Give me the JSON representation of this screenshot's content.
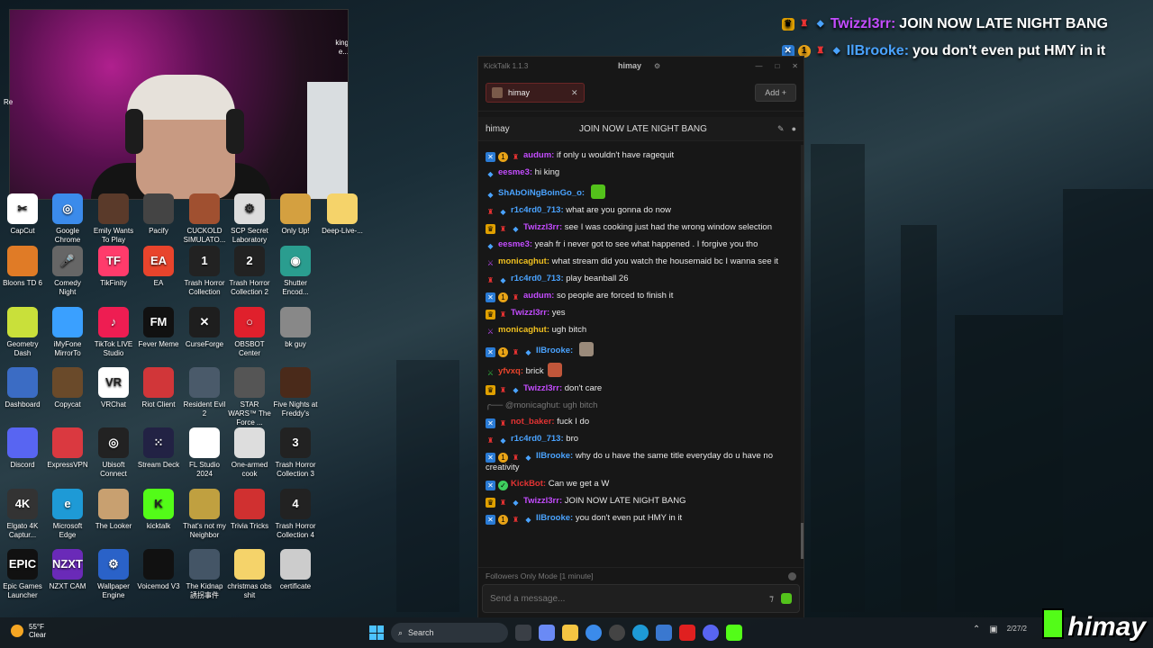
{
  "overlay": {
    "lines": [
      {
        "user": "Twizzl3rr:",
        "text": "JOIN NOW LATE NIGHT BANG"
      },
      {
        "user": "IlBrooke:",
        "text": "you don't even put HMY in it"
      }
    ]
  },
  "desktop": {
    "partial_labels": [
      "king",
      "e...",
      "Re"
    ],
    "icons": [
      {
        "label": "CapCut",
        "color": "#ffffff",
        "glyph": "✂"
      },
      {
        "label": "Google Chrome",
        "color": "#3b8beb",
        "glyph": "◎"
      },
      {
        "label": "Emily Wants To Play",
        "color": "#5a3a2a",
        "glyph": ""
      },
      {
        "label": "Pacify",
        "color": "#444444",
        "glyph": ""
      },
      {
        "label": "CUCKOLD SIMULATO...",
        "color": "#a05030",
        "glyph": ""
      },
      {
        "label": "SCP Secret Laboratory",
        "color": "#dddddd",
        "glyph": "⚙"
      },
      {
        "label": "Only Up!",
        "color": "#d4a040",
        "glyph": ""
      },
      {
        "label": "Deep-Live-...",
        "color": "#f5d36a",
        "glyph": ""
      },
      {
        "label": "Bloons TD 6",
        "color": "#e07b26",
        "glyph": ""
      },
      {
        "label": "Comedy Night",
        "color": "#666666",
        "glyph": "🎤"
      },
      {
        "label": "TikFinity",
        "color": "#ff3b6b",
        "glyph": "TF"
      },
      {
        "label": "EA",
        "color": "#e8442c",
        "glyph": "EA"
      },
      {
        "label": "Trash Horror Collection",
        "color": "#222222",
        "glyph": "1"
      },
      {
        "label": "Trash Horror Collection 2",
        "color": "#222222",
        "glyph": "2"
      },
      {
        "label": "Shutter Encod...",
        "color": "#2a9d8f",
        "glyph": "◉"
      },
      {
        "label": "Geometry Dash",
        "color": "#c9e03a",
        "glyph": ""
      },
      {
        "label": "iMyFone MirrorTo",
        "color": "#3aa0ff",
        "glyph": ""
      },
      {
        "label": "TikTok LIVE Studio",
        "color": "#ee1d52",
        "glyph": "♪"
      },
      {
        "label": "Fever Meme",
        "color": "#111111",
        "glyph": "FM"
      },
      {
        "label": "CurseForge",
        "color": "#1e1e1e",
        "glyph": "✕"
      },
      {
        "label": "OBSBOT Center",
        "color": "#e0202c",
        "glyph": "○"
      },
      {
        "label": "bk guy",
        "color": "#888888",
        "glyph": ""
      },
      {
        "label": "Dashboard",
        "color": "#3b6cc4",
        "glyph": ""
      },
      {
        "label": "Copycat",
        "color": "#6a4a2a",
        "glyph": ""
      },
      {
        "label": "VRChat",
        "color": "#ffffff",
        "glyph": "VR"
      },
      {
        "label": "Riot Client",
        "color": "#d13639",
        "glyph": ""
      },
      {
        "label": "Resident Evil 2",
        "color": "#4a5a6a",
        "glyph": ""
      },
      {
        "label": "STAR WARS™ The Force ...",
        "color": "#555555",
        "glyph": ""
      },
      {
        "label": "Five Nights at Freddy's",
        "color": "#4a2a1a",
        "glyph": ""
      },
      {
        "label": "Discord",
        "color": "#5865f2",
        "glyph": ""
      },
      {
        "label": "ExpressVPN",
        "color": "#da3940",
        "glyph": ""
      },
      {
        "label": "Ubisoft Connect",
        "color": "#222222",
        "glyph": "◎"
      },
      {
        "label": "Stream Deck",
        "color": "#222244",
        "glyph": "⁙"
      },
      {
        "label": "FL Studio 2024",
        "color": "#ffffff",
        "glyph": ""
      },
      {
        "label": "One-armed cook",
        "color": "#dddddd",
        "glyph": ""
      },
      {
        "label": "Trash Horror Collection 3",
        "color": "#222222",
        "glyph": "3"
      },
      {
        "label": "Elgato 4K Captur...",
        "color": "#333333",
        "glyph": "4K"
      },
      {
        "label": "Microsoft Edge",
        "color": "#1e9ad6",
        "glyph": "e"
      },
      {
        "label": "The Looker",
        "color": "#c8a070",
        "glyph": ""
      },
      {
        "label": "kicktalk",
        "color": "#53fc18",
        "glyph": "K"
      },
      {
        "label": "That's not my Neighbor",
        "color": "#c0a040",
        "glyph": ""
      },
      {
        "label": "Trivia Tricks",
        "color": "#d03030",
        "glyph": ""
      },
      {
        "label": "Trash Horror Collection 4",
        "color": "#222222",
        "glyph": "4"
      },
      {
        "label": "Epic Games Launcher",
        "color": "#111111",
        "glyph": "EPIC"
      },
      {
        "label": "NZXT CAM",
        "color": "#6a2ab8",
        "glyph": "NZXT"
      },
      {
        "label": "Wallpaper Engine",
        "color": "#2a62c8",
        "glyph": "⚙"
      },
      {
        "label": "Voicemod V3",
        "color": "#111111",
        "glyph": ""
      },
      {
        "label": "The Kidnap 誘拐事件",
        "color": "#445566",
        "glyph": ""
      },
      {
        "label": "christmas obs shit",
        "color": "#f5d36a",
        "glyph": ""
      },
      {
        "label": "certificate",
        "color": "#cccccc",
        "glyph": ""
      }
    ]
  },
  "kicktalk": {
    "app_title": "KickTalk 1.1.3",
    "window_center": "himay",
    "tab_name": "himay",
    "add_label": "Add",
    "channel": "himay",
    "stream_title": "JOIN NOW LATE NIGHT BANG",
    "followers_mode": "Followers Only Mode [1 minute]",
    "input_placeholder": "Send a message...",
    "messages": [
      {
        "badges": [
          "vip",
          "sub",
          "gift"
        ],
        "user": "audum:",
        "color": "#c44cff",
        "text": "if only u wouldn't have ragequit"
      },
      {
        "badges": [
          "gem"
        ],
        "user": "eesme3:",
        "color": "#c44cff",
        "text": "hi king"
      },
      {
        "badges": [
          "gem"
        ],
        "user": "ShAbOiNgBoinGo_o:",
        "color": "#4aa3ff",
        "text": "",
        "emote": "#53c21b"
      },
      {
        "badges": [
          "gift",
          "gem"
        ],
        "user": "r1c4rd0_713:",
        "color": "#4aa3ff",
        "text": "what are you gonna do now"
      },
      {
        "badges": [
          "crown",
          "gift",
          "gem"
        ],
        "user": "Twizzl3rr:",
        "color": "#c44cff",
        "text": "see I was cooking just had the wrong window selection"
      },
      {
        "badges": [
          "gem"
        ],
        "user": "eesme3:",
        "color": "#c44cff",
        "text": "yeah fr i never got to see what happened . I forgive you tho"
      },
      {
        "badges": [
          "og"
        ],
        "user": "monicaghut:",
        "color": "#f0c020",
        "text": "what stream did you watch the housemaid bc I wanna see it"
      },
      {
        "badges": [
          "gift",
          "gem"
        ],
        "user": "r1c4rd0_713:",
        "color": "#4aa3ff",
        "text": "play beanball 26"
      },
      {
        "badges": [
          "vip",
          "sub",
          "gift"
        ],
        "user": "audum:",
        "color": "#c44cff",
        "text": "so people are forced to finish it"
      },
      {
        "badges": [
          "crown",
          "gift"
        ],
        "user": "Twizzl3rr:",
        "color": "#c44cff",
        "text": "yes"
      },
      {
        "badges": [
          "og"
        ],
        "user": "monicaghut:",
        "color": "#f0c020",
        "text": "ugh bitch"
      },
      {
        "badges": [
          "vip",
          "sub",
          "gift",
          "gem"
        ],
        "user": "IlBrooke:",
        "color": "#4aa3ff",
        "text": "",
        "emote": "#9a8a7a"
      },
      {
        "badges": [
          "mod"
        ],
        "user": "yfvxq:",
        "color": "#e8442c",
        "text": "brick",
        "emote": "#c0563a"
      },
      {
        "badges": [
          "crown",
          "gift",
          "gem"
        ],
        "user": "Twizzl3rr:",
        "color": "#c44cff",
        "text": "don't care"
      },
      {
        "reply": true,
        "text": "@monicaghut: ugh bitch"
      },
      {
        "badges": [
          "vip",
          "gift"
        ],
        "user": "not_baker:",
        "color": "#e33333",
        "text": "fuck I do"
      },
      {
        "badges": [
          "gift",
          "gem"
        ],
        "user": "r1c4rd0_713:",
        "color": "#4aa3ff",
        "text": "bro"
      },
      {
        "badges": [
          "vip",
          "sub",
          "gift",
          "gem"
        ],
        "user": "IlBrooke:",
        "color": "#4aa3ff",
        "text": "why do u have the same title everyday do u have no creativity"
      },
      {
        "badges": [
          "vip",
          "verified"
        ],
        "user": "KickBot:",
        "color": "#e33333",
        "text": "Can we get a W"
      },
      {
        "badges": [
          "crown",
          "gift",
          "gem"
        ],
        "user": "Twizzl3rr:",
        "color": "#c44cff",
        "text": "JOIN NOW LATE NIGHT BANG"
      },
      {
        "badges": [
          "vip",
          "sub",
          "gift",
          "gem"
        ],
        "user": "IlBrooke:",
        "color": "#4aa3ff",
        "text": "you don't even put HMY in it"
      }
    ]
  },
  "taskbar": {
    "weather_temp": "55°F",
    "weather_desc": "Clear",
    "search_label": "Search",
    "clock_date": "2/27/2"
  },
  "brand_text": "himay"
}
